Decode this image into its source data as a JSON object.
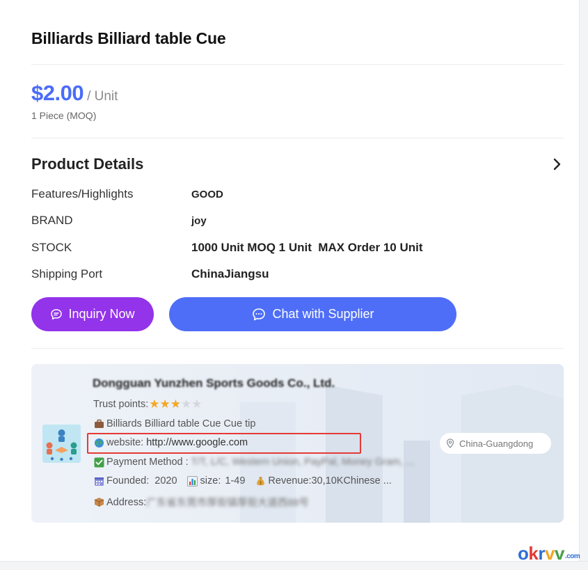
{
  "product": {
    "title": "Billiards Billiard table Cue",
    "price": "$2.00",
    "unit": "/ Unit",
    "moq": "1 Piece (MOQ)"
  },
  "details": {
    "title": "Product Details",
    "rows": [
      {
        "label": "Features/Highlights",
        "value": "GOOD"
      },
      {
        "label": "BRAND",
        "value": "joy"
      },
      {
        "label": "STOCK",
        "value": "1000 Unit MOQ 1 Unit  MAX Order 10 Unit"
      },
      {
        "label": "Shipping Port",
        "value": "ChinaJiangsu"
      }
    ]
  },
  "actions": {
    "inquiry_label": "Inquiry Now",
    "chat_label": "Chat with Supplier"
  },
  "supplier": {
    "name": "Dongguan Yunzhen Sports Goods Co., Ltd.",
    "trust_label": "Trust points:",
    "trust_rating": 3,
    "trust_max": 5,
    "products": "Billiards Billiard table Cue Cue tip",
    "website_label": "website:",
    "website": "http://www.google.com",
    "payment_label": "Payment Method :",
    "payment_value": "T/T, L/C, Western Union, PayPal, Money Gram, ...",
    "founded_label": "Founded:",
    "founded": "2020",
    "size_label": "size:",
    "size": "1-49",
    "revenue_label": "Revenue:",
    "revenue": "30,10KChinese ...",
    "address_label": "Address:",
    "address_value": "广东省东莞市厚街镇厚街大道西88号",
    "location": "China-Guangdong"
  },
  "watermark": {
    "letters": [
      "o",
      "k",
      "r",
      "v",
      "v"
    ],
    "domain": ".com",
    "colors": [
      "#2f6fd6",
      "#e53935",
      "#2f6fd6",
      "#f5a623",
      "#43a047"
    ]
  },
  "colors": {
    "price": "#4a6cf7",
    "inquiry": "#9333ea",
    "chat": "#4f6ef7",
    "highlight": "#e53935"
  }
}
